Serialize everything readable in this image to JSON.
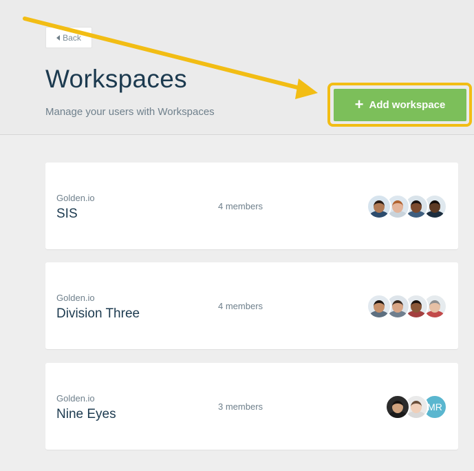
{
  "header": {
    "back_label": "Back",
    "title": "Workspaces",
    "subtitle": "Manage your users with Workspaces",
    "add_button_label": "Add workspace"
  },
  "colors": {
    "accent_green": "#7cbf5a",
    "highlight_yellow": "#f2bd14",
    "title_navy": "#1c3a4f"
  },
  "workspaces": [
    {
      "org": "Golden.io",
      "name": "SIS",
      "members_label": "4 members",
      "avatars": [
        {
          "type": "photo",
          "skin": "#b07a55",
          "hair": "#2a1c14",
          "bg": "#d7e4ee",
          "shirt": "#2d4c6d"
        },
        {
          "type": "photo",
          "skin": "#e3b49a",
          "hair": "#b0622f",
          "bg": "#dde7ef",
          "shirt": "#c9d3db"
        },
        {
          "type": "photo",
          "skin": "#7b4a2e",
          "hair": "#1a1210",
          "bg": "#d9e3ea",
          "shirt": "#3e5e7f"
        },
        {
          "type": "photo",
          "skin": "#5c3a24",
          "hair": "#120c09",
          "bg": "#dfe8ee",
          "shirt": "#1d2e3f"
        }
      ]
    },
    {
      "org": "Golden.io",
      "name": "Division Three",
      "members_label": "4 members",
      "avatars": [
        {
          "type": "photo",
          "skin": "#c6906a",
          "hair": "#1e1511",
          "bg": "#e2e9ef",
          "shirt": "#5d6f80"
        },
        {
          "type": "photo",
          "skin": "#d8a585",
          "hair": "#3c2a1e",
          "bg": "#dde4ea",
          "shirt": "#6f7f8e"
        },
        {
          "type": "photo",
          "skin": "#8a5738",
          "hair": "#1b120d",
          "bg": "#e4e9ed",
          "shirt": "#a33f3f"
        },
        {
          "type": "photo",
          "skin": "#e6c0a5",
          "hair": "#8f8f8f",
          "bg": "#e6ebee",
          "shirt": "#c24a4a"
        }
      ]
    },
    {
      "org": "Golden.io",
      "name": "Nine Eyes",
      "members_label": "3 members",
      "avatars": [
        {
          "type": "photo",
          "skin": "#d0a37f",
          "hair": "#161210",
          "bg": "#2b2b2b",
          "shirt": "#1a1a1a"
        },
        {
          "type": "photo",
          "skin": "#f0cfb9",
          "hair": "#6a4e3a",
          "bg": "#eaeaea",
          "shirt": "#d9d9d9"
        },
        {
          "type": "initials",
          "initials": "MR",
          "bg": "#5ab6cf"
        }
      ]
    }
  ]
}
